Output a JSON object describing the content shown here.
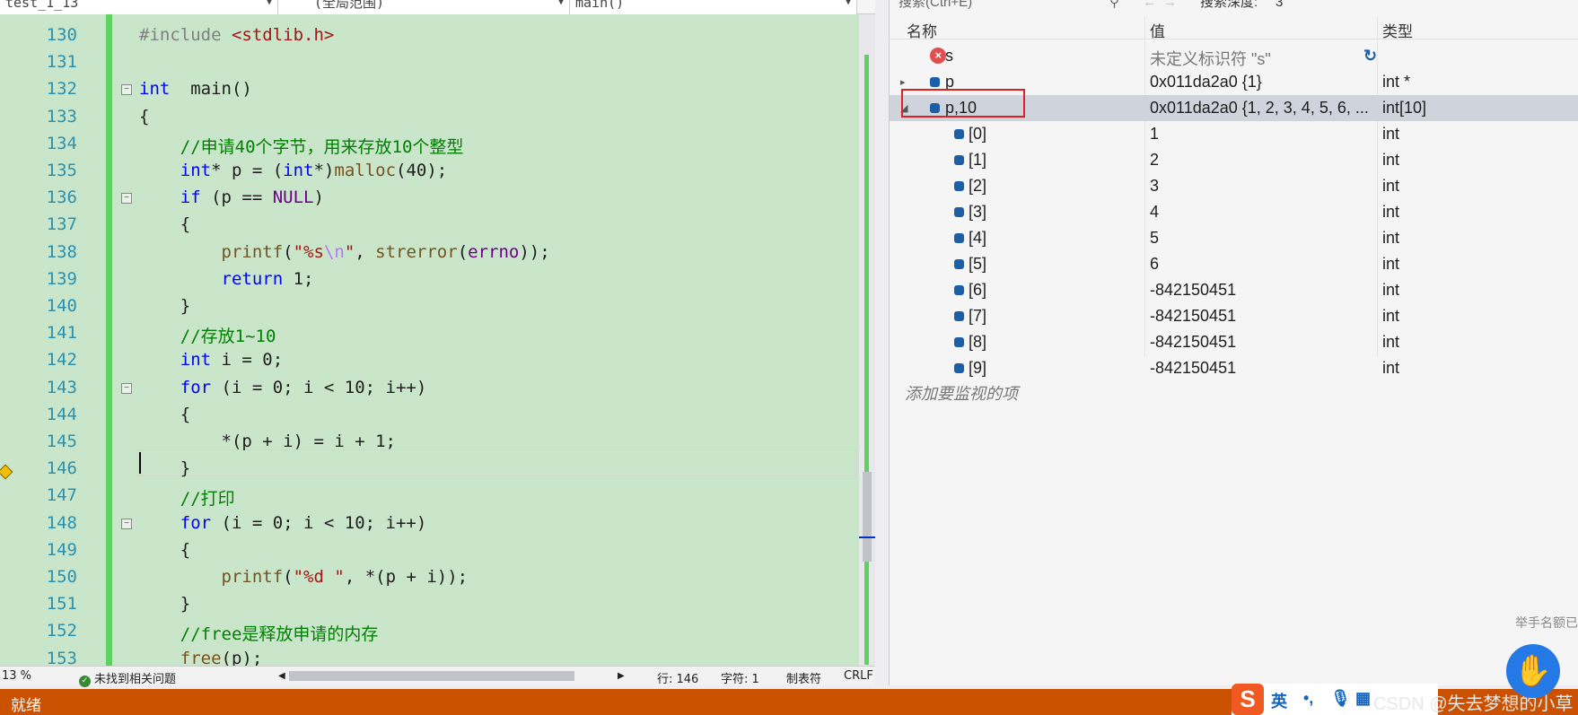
{
  "toolbar": {
    "project": "test_1_13",
    "scope": "(全局范围)",
    "function": "main()"
  },
  "code": {
    "lines": [
      {
        "n": "130",
        "t": [
          [
            "pp",
            "#include "
          ],
          [
            "st",
            "<stdlib.h>"
          ]
        ]
      },
      {
        "n": "131",
        "t": []
      },
      {
        "n": "132",
        "t": [
          [
            "kw",
            "int"
          ],
          [
            "",
            "  main()"
          ]
        ],
        "fold": true
      },
      {
        "n": "133",
        "t": [
          [
            "",
            "{"
          ]
        ]
      },
      {
        "n": "134",
        "t": [
          [
            "",
            "    "
          ],
          [
            "cm",
            "//申请40个字节，用来存放10个整型"
          ]
        ]
      },
      {
        "n": "135",
        "t": [
          [
            "",
            "    "
          ],
          [
            "kw",
            "int"
          ],
          [
            "",
            "* p = ("
          ],
          [
            "kw",
            "int"
          ],
          [
            "",
            "*)"
          ],
          [
            "fn",
            "malloc"
          ],
          [
            "",
            "(40);"
          ]
        ]
      },
      {
        "n": "136",
        "t": [
          [
            "",
            "    "
          ],
          [
            "kw",
            "if"
          ],
          [
            "",
            " (p == "
          ],
          [
            "mc",
            "NULL"
          ],
          [
            "",
            ")"
          ]
        ],
        "fold": true
      },
      {
        "n": "137",
        "t": [
          [
            "",
            "    {"
          ]
        ]
      },
      {
        "n": "138",
        "t": [
          [
            "",
            "        "
          ],
          [
            "fn",
            "printf"
          ],
          [
            "",
            "("
          ],
          [
            "st",
            "\"%s"
          ],
          [
            "es",
            "\\n"
          ],
          [
            "st",
            "\""
          ],
          [
            "",
            ", "
          ],
          [
            "fn",
            "strerror"
          ],
          [
            "",
            "("
          ],
          [
            "mc",
            "errno"
          ],
          [
            "",
            "));"
          ]
        ]
      },
      {
        "n": "139",
        "t": [
          [
            "",
            "        "
          ],
          [
            "kw",
            "return"
          ],
          [
            "",
            " 1;"
          ]
        ]
      },
      {
        "n": "140",
        "t": [
          [
            "",
            "    }"
          ]
        ]
      },
      {
        "n": "141",
        "t": [
          [
            "",
            "    "
          ],
          [
            "cm",
            "//存放1~10"
          ]
        ]
      },
      {
        "n": "142",
        "t": [
          [
            "",
            "    "
          ],
          [
            "kw",
            "int"
          ],
          [
            "",
            " i = 0;"
          ]
        ]
      },
      {
        "n": "143",
        "t": [
          [
            "",
            "    "
          ],
          [
            "kw",
            "for"
          ],
          [
            "",
            " (i = 0; i < 10; i++)"
          ]
        ],
        "fold": true
      },
      {
        "n": "144",
        "t": [
          [
            "",
            "    {"
          ]
        ]
      },
      {
        "n": "145",
        "t": [
          [
            "",
            "        *(p + i) = i + 1;"
          ]
        ]
      },
      {
        "n": "146",
        "t": [
          [
            "",
            "    }"
          ]
        ]
      },
      {
        "n": "147",
        "t": [
          [
            "",
            "    "
          ],
          [
            "cm",
            "//打印"
          ]
        ]
      },
      {
        "n": "148",
        "t": [
          [
            "",
            "    "
          ],
          [
            "kw",
            "for"
          ],
          [
            "",
            " (i = 0; i < 10; i++)"
          ]
        ],
        "fold": true
      },
      {
        "n": "149",
        "t": [
          [
            "",
            "    {"
          ]
        ]
      },
      {
        "n": "150",
        "t": [
          [
            "",
            "        "
          ],
          [
            "fn",
            "printf"
          ],
          [
            "",
            "("
          ],
          [
            "st",
            "\"%d \""
          ],
          [
            "",
            ", *(p + i));"
          ]
        ]
      },
      {
        "n": "151",
        "t": [
          [
            "",
            "    }"
          ]
        ]
      },
      {
        "n": "152",
        "t": [
          [
            "",
            "    "
          ],
          [
            "cm",
            "//free是释放申请的内存"
          ]
        ]
      },
      {
        "n": "153",
        "t": [
          [
            "",
            "    "
          ],
          [
            "fn",
            "free"
          ],
          [
            "",
            "(p);"
          ]
        ]
      }
    ]
  },
  "editor_status": {
    "zoom": "13 %",
    "issues": "未找到相关问题",
    "line": "行: 146",
    "char": "字符: 1",
    "indent": "制表符",
    "eol": "CRLF"
  },
  "watch": {
    "search_placeholder": "搜索(Ctrl+E)",
    "depth_label": "搜索深度:",
    "depth_value": "3",
    "headers": {
      "name": "名称",
      "value": "值",
      "type": "类型"
    },
    "rows": [
      {
        "name": "s",
        "value": "未定义标识符 \"s\"",
        "type": "",
        "icon": "error-icon"
      },
      {
        "name": "p",
        "value": "0x011da2a0 {1}",
        "type": "int *",
        "expander": "▸"
      },
      {
        "name": "p,10",
        "value": "0x011da2a0 {1, 2, 3, 4, 5, 6, ...",
        "type": "int[10]",
        "expander": "◢",
        "selected": true
      },
      {
        "name": "[0]",
        "value": "1",
        "type": "int"
      },
      {
        "name": "[1]",
        "value": "2",
        "type": "int"
      },
      {
        "name": "[2]",
        "value": "3",
        "type": "int"
      },
      {
        "name": "[3]",
        "value": "4",
        "type": "int"
      },
      {
        "name": "[4]",
        "value": "5",
        "type": "int"
      },
      {
        "name": "[5]",
        "value": "6",
        "type": "int"
      },
      {
        "name": "[6]",
        "value": "-842150451",
        "type": "int"
      },
      {
        "name": "[7]",
        "value": "-842150451",
        "type": "int"
      },
      {
        "name": "[8]",
        "value": "-842150451",
        "type": "int"
      },
      {
        "name": "[9]",
        "value": "-842150451",
        "type": "int"
      }
    ],
    "add_item": "添加要监视的项"
  },
  "statusbar": {
    "ready": "就绪",
    "color": "#ca5100"
  },
  "overlay": {
    "ime_lang": "英",
    "watermark": "CSDN @失去梦想的小草",
    "raise_hand": "举手名额已"
  }
}
